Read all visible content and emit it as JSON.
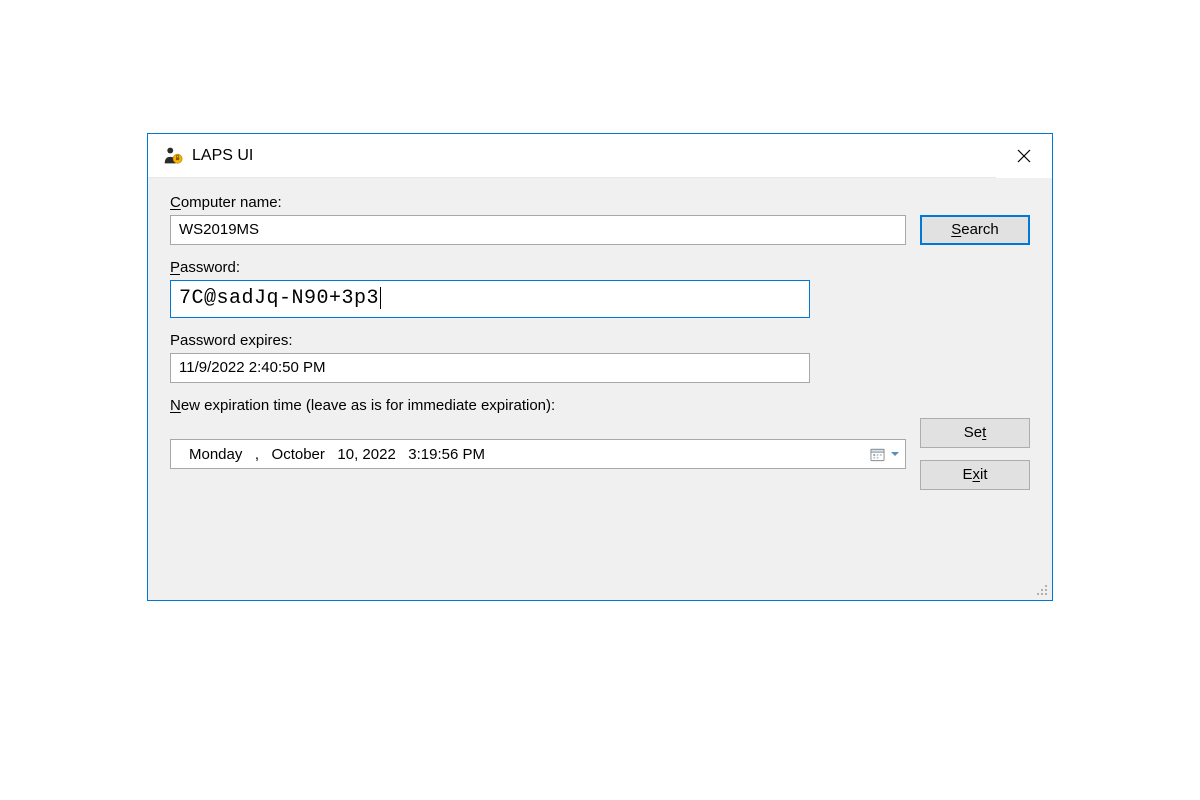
{
  "window": {
    "title": "LAPS UI"
  },
  "labels": {
    "computer_name_prefix": "C",
    "computer_name_rest": "omputer name:",
    "password_prefix": "P",
    "password_rest": "assword:",
    "password_expires": "Password expires:",
    "new_expiration_prefix": "N",
    "new_expiration_rest": "ew expiration time (leave as is for immediate expiration):"
  },
  "fields": {
    "computer_name": "WS2019MS",
    "password": "7C@sadJq-N90+3p3",
    "password_expires": "11/9/2022 2:40:50 PM",
    "new_expiration": "Monday   ,   October   10, 2022   3:19:56 PM"
  },
  "buttons": {
    "search_prefix": "S",
    "search_rest": "earch",
    "set_prefix": "t",
    "set_before": "Se",
    "exit_prefix": "x",
    "exit_before": "E",
    "exit_after": "it"
  }
}
